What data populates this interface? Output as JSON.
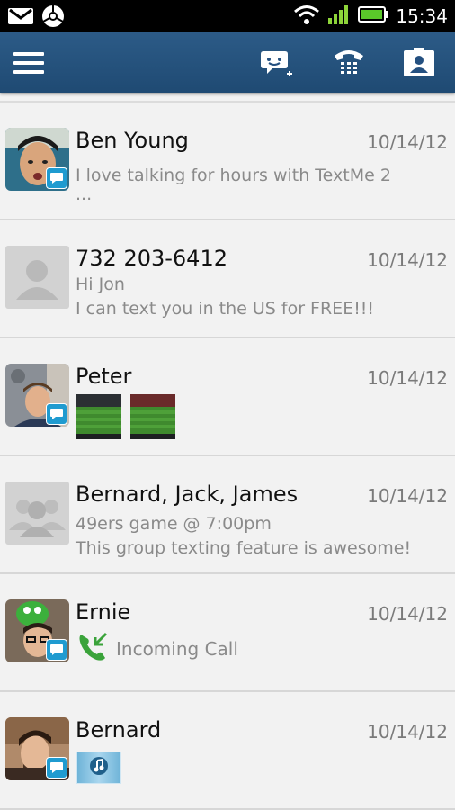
{
  "status_bar": {
    "time": "15:34",
    "icons": [
      "gmail-icon",
      "chrome-icon",
      "wifi-icon",
      "signal-icon",
      "battery-icon"
    ]
  },
  "action_bar": {
    "icons": [
      "menu-icon",
      "new-message-icon",
      "dialpad-icon",
      "contacts-icon"
    ]
  },
  "conversations": [
    {
      "name": "Ben Young",
      "date": "10/14/12",
      "preview_lines": [
        "I love talking for hours with TextMe 2",
        "..."
      ],
      "avatar": "photo",
      "badge": true
    },
    {
      "name": "732 203-6412",
      "date": "10/14/12",
      "preview_lines": [
        "Hi Jon",
        "I can text you in the US for FREE!!!"
      ],
      "avatar": "default-person",
      "badge": false
    },
    {
      "name": "Peter",
      "date": "10/14/12",
      "attachments": [
        "stadium-photo",
        "stadium-photo"
      ],
      "avatar": "photo",
      "badge": true
    },
    {
      "name": "Bernard, Jack, James",
      "date": "10/14/12",
      "preview_lines": [
        "49ers game @ 7:00pm",
        "This group texting feature is awesome!"
      ],
      "avatar": "default-group",
      "badge": false
    },
    {
      "name": "Ernie",
      "date": "10/14/12",
      "call_label": "Incoming Call",
      "avatar": "photo",
      "badge": true
    },
    {
      "name": "Bernard",
      "date": "10/14/12",
      "attachments": [
        "audio-clip"
      ],
      "avatar": "photo",
      "badge": true
    }
  ],
  "colors": {
    "action_bar": "#245080",
    "status_bar": "#000000",
    "list_bg": "#f2f2f2",
    "badge": "#1f9bd0",
    "call_green": "#3aa33a"
  }
}
